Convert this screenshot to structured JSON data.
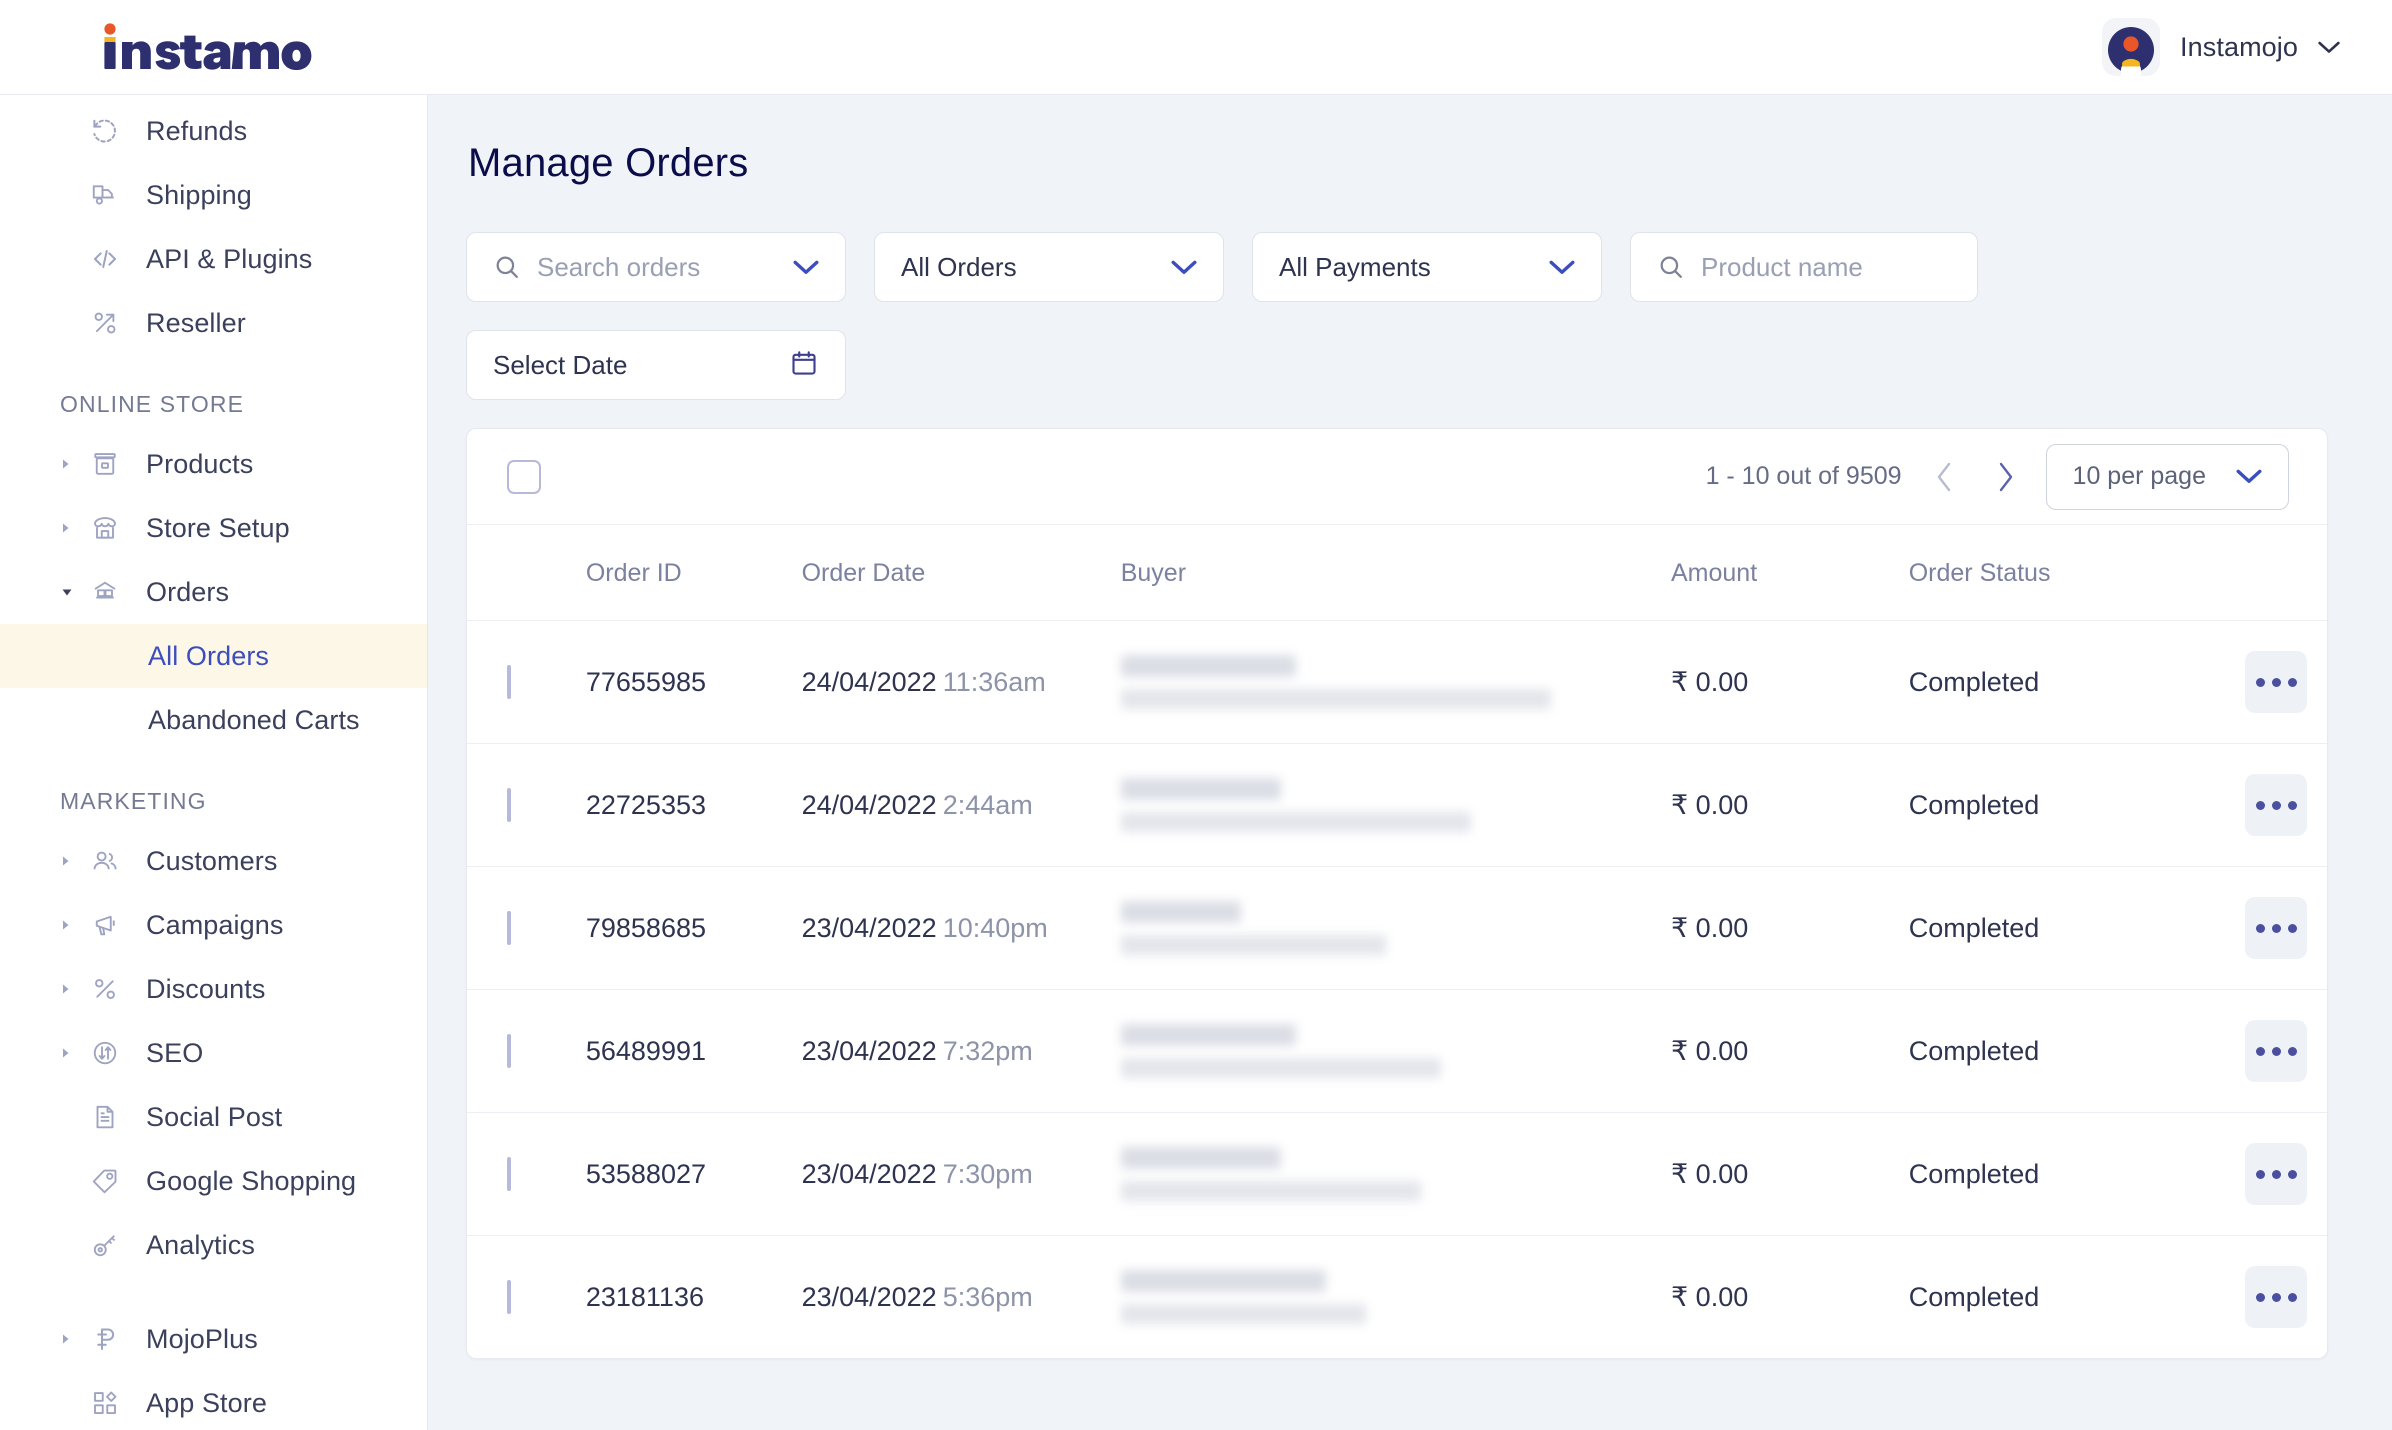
{
  "header": {
    "logo_text": "instamojo",
    "account_name": "Instamojo",
    "chevron_icon": "chevron-down-icon",
    "avatar_icon": "user-avatar-icon"
  },
  "sidebar": {
    "items": [
      {
        "label": "Refunds",
        "icon": "refund-icon",
        "caret": false,
        "active": false,
        "child": false
      },
      {
        "label": "Shipping",
        "icon": "shipping-truck-icon",
        "caret": false,
        "active": false,
        "child": false
      },
      {
        "label": "API & Plugins",
        "icon": "code-icon",
        "caret": false,
        "active": false,
        "child": false
      },
      {
        "label": "Reseller",
        "icon": "percent-icon",
        "caret": false,
        "active": false,
        "child": false
      }
    ],
    "section_online_store": "ONLINE STORE",
    "online_store_items": [
      {
        "label": "Products",
        "icon": "product-box-icon",
        "caret": "right",
        "active": false,
        "child": false
      },
      {
        "label": "Store Setup",
        "icon": "storefront-icon",
        "caret": "right",
        "active": false,
        "child": false
      },
      {
        "label": "Orders",
        "icon": "orders-boxes-icon",
        "caret": "down",
        "active": false,
        "child": false
      },
      {
        "label": "All Orders",
        "icon": "",
        "caret": "",
        "active": true,
        "child": true
      },
      {
        "label": "Abandoned Carts",
        "icon": "",
        "caret": "",
        "active": false,
        "child": true
      }
    ],
    "section_marketing": "MARKETING",
    "marketing_items": [
      {
        "label": "Customers",
        "icon": "customers-icon",
        "caret": "right",
        "active": false,
        "child": false
      },
      {
        "label": "Campaigns",
        "icon": "megaphone-icon",
        "caret": "right",
        "active": false,
        "child": false
      },
      {
        "label": "Discounts",
        "icon": "percent-icon",
        "caret": "right",
        "active": false,
        "child": false
      },
      {
        "label": "SEO",
        "icon": "seo-arrows-circle-icon",
        "caret": "right",
        "active": false,
        "child": false
      },
      {
        "label": "Social Post",
        "icon": "document-lines-icon",
        "caret": false,
        "active": false,
        "child": false
      },
      {
        "label": "Google Shopping",
        "icon": "price-tag-g-icon",
        "caret": false,
        "active": false,
        "child": false
      },
      {
        "label": "Analytics",
        "icon": "analytics-key-icon",
        "caret": false,
        "active": false,
        "child": false
      }
    ],
    "bottom_items": [
      {
        "label": "MojoPlus",
        "icon": "mojoplus-icon",
        "caret": "right",
        "active": false,
        "child": false
      },
      {
        "label": "App Store",
        "icon": "app-store-grid-icon",
        "caret": false,
        "active": false,
        "child": false
      }
    ]
  },
  "main": {
    "page_title": "Manage Orders",
    "filters": {
      "search_placeholder": "Search orders",
      "search_icon": "search-icon",
      "search_chevron": "chevron-down-icon",
      "orders_select": "All Orders",
      "payments_select": "All Payments",
      "product_placeholder": "Product name",
      "product_icon": "search-icon",
      "date_label": "Select Date",
      "date_icon": "calendar-icon"
    },
    "toolbar": {
      "select_all_checkbox": "unchecked",
      "pagination_text": "1 - 10 out of 9509",
      "prev_icon": "chevron-left-icon",
      "next_icon": "chevron-right-icon",
      "per_page_label": "10 per page",
      "per_page_chevron": "chevron-down-icon"
    },
    "table": {
      "columns": [
        "Order ID",
        "Order Date",
        "Buyer",
        "Amount",
        "Order Status"
      ],
      "rows": [
        {
          "order_id": "77655985",
          "date": "24/04/2022",
          "time": "11:36am",
          "buyer": "",
          "amount": "₹ 0.00",
          "status": "Completed",
          "action_icon": "more-options-icon"
        },
        {
          "order_id": "22725353",
          "date": "24/04/2022",
          "time": "2:44am",
          "buyer": "",
          "amount": "₹ 0.00",
          "status": "Completed",
          "action_icon": "more-options-icon"
        },
        {
          "order_id": "79858685",
          "date": "23/04/2022",
          "time": "10:40pm",
          "buyer": "",
          "amount": "₹ 0.00",
          "status": "Completed",
          "action_icon": "more-options-icon"
        },
        {
          "order_id": "56489991",
          "date": "23/04/2022",
          "time": "7:32pm",
          "buyer": "",
          "amount": "₹ 0.00",
          "status": "Completed",
          "action_icon": "more-options-icon"
        },
        {
          "order_id": "53588027",
          "date": "23/04/2022",
          "time": "7:30pm",
          "buyer": "",
          "amount": "₹ 0.00",
          "status": "Completed",
          "action_icon": "more-options-icon"
        },
        {
          "order_id": "23181136",
          "date": "23/04/2022",
          "time": "5:36pm",
          "buyer": "",
          "amount": "₹ 0.00",
          "status": "Completed",
          "action_icon": "more-options-icon"
        }
      ]
    }
  },
  "colors": {
    "brand_navy": "#2d2f6e",
    "brand_orange": "#e8562a",
    "brand_yellow": "#f5b51e",
    "accent_blue": "#3c4dbd",
    "active_row_bg": "#fdf7e7",
    "page_bg": "#f0f3f7",
    "title": "#0b0c4a",
    "sidebar_text": "#3b405c",
    "muted_text": "#7b81a0"
  }
}
